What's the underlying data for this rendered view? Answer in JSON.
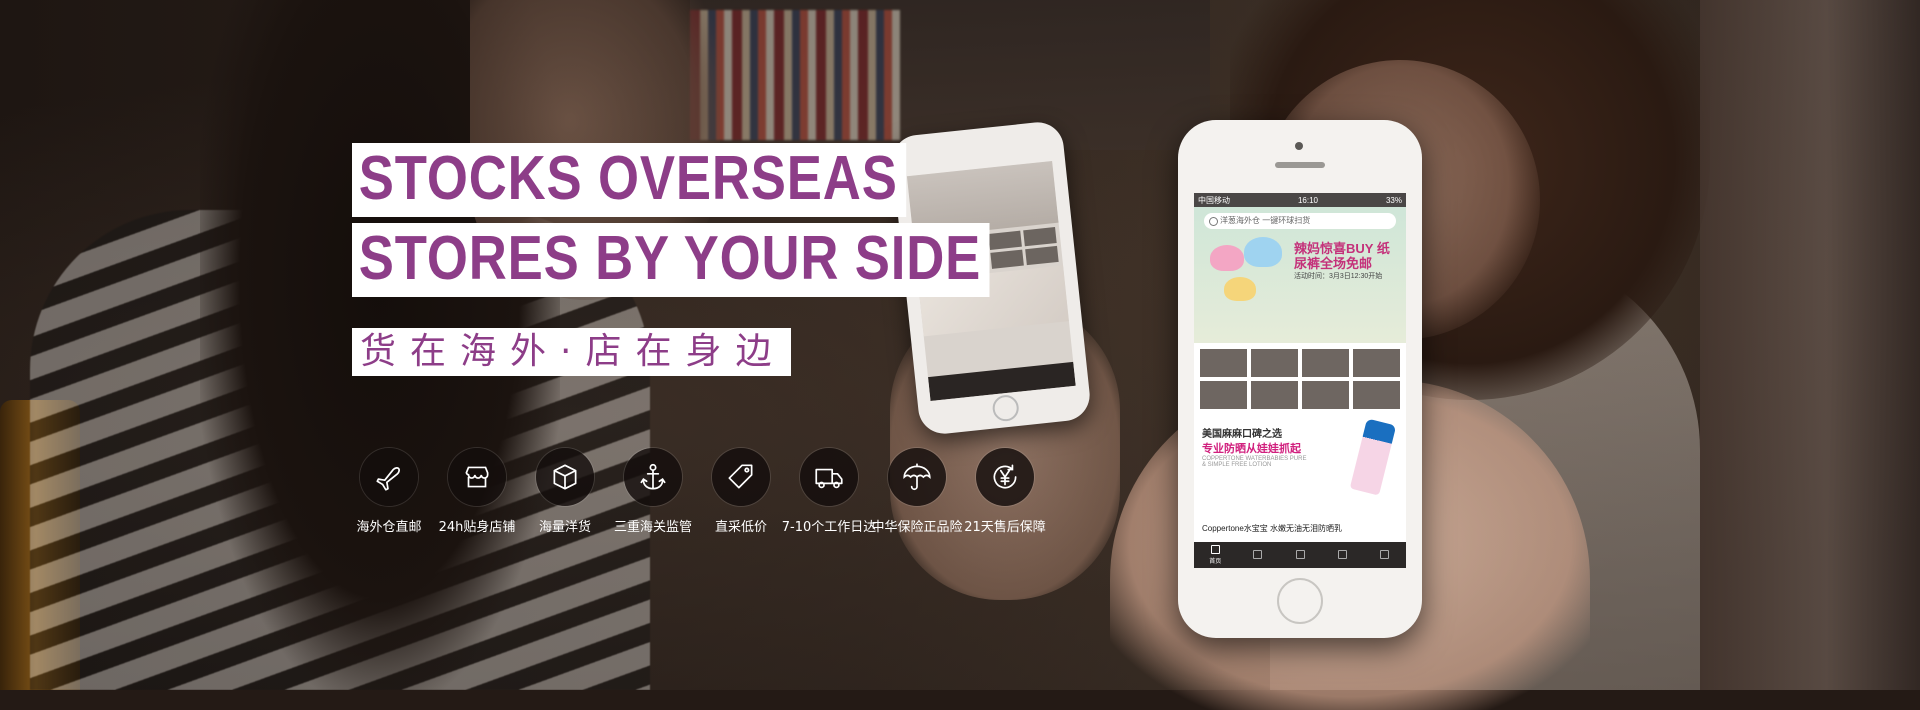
{
  "hero": {
    "headline_line1": "STOCKS OVERSEAS",
    "headline_line2": "STORES BY YOUR SIDE",
    "subtitle": "货在海外·店在身边",
    "accent_color": "#8d3d88"
  },
  "features": [
    {
      "icon": "airplane-icon",
      "label": "海外仓直邮"
    },
    {
      "icon": "store-icon",
      "label": "24h贴身店铺"
    },
    {
      "icon": "box-icon",
      "label": "海量洋货"
    },
    {
      "icon": "anchor-icon",
      "label": "三重海关监管"
    },
    {
      "icon": "price-tag-icon",
      "label": "直采低价"
    },
    {
      "icon": "truck-icon",
      "label": "7-10个工作日达"
    },
    {
      "icon": "umbrella-icon",
      "label": "中华保险正品险"
    },
    {
      "icon": "yen-refresh-icon",
      "label": "21天售后保障"
    }
  ],
  "phone": {
    "status_carrier": "中国移动",
    "status_time": "16:10",
    "status_battery": "33%",
    "search_text": "洋葱海外仓 一键环球扫货",
    "hero_title": "辣妈惊喜BUY 纸尿裤全场免邮",
    "hero_sub": "活动时间：3月3日12:30开始",
    "categories": [
      "",
      "",
      "",
      "",
      "",
      "",
      "",
      ""
    ],
    "promo_line1": "美国麻麻口碑之选",
    "promo_line2": "专业防晒从娃娃抓起",
    "promo_line3": "COPPERTONE WATERBABIES PURE & SIMPLE FREE LOTION",
    "product_name": "Coppertone水宝宝 水嫩无油无泪防晒乳",
    "tabs": [
      "首页",
      "",
      "",
      "",
      ""
    ]
  }
}
